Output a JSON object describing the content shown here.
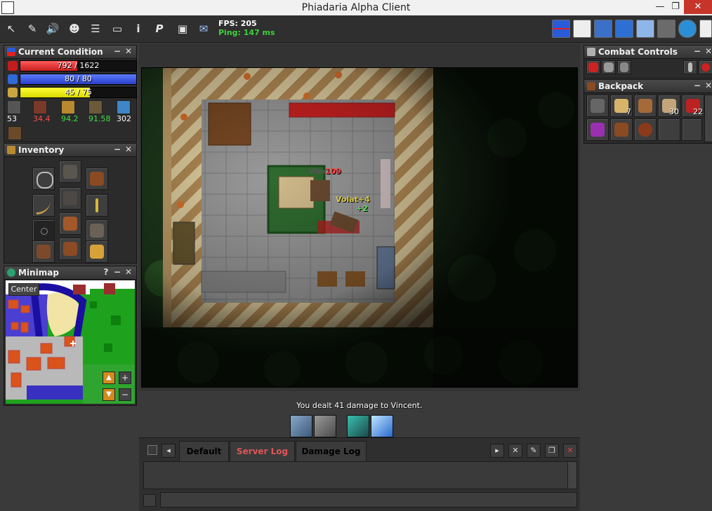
{
  "window": {
    "title": "Phiadaria Alpha Client",
    "minimize": "—",
    "restore": "❐",
    "close": "✕"
  },
  "toolbar": {
    "fps": "FPS: 205",
    "ping": "Ping: 147 ms",
    "left_icons": [
      "cursor-icon",
      "pen-icon",
      "speaker-icon",
      "character-icon",
      "list-icon",
      "window-icon",
      "info-icon",
      "premium-icon",
      "screenshot-icon",
      "scroll-icon"
    ],
    "left_glyphs": [
      "↖",
      "✎",
      "🔊",
      "☻",
      "☰",
      "▭",
      "i",
      "P",
      "▣",
      "✉"
    ],
    "right_icons": [
      "health-mana-icon",
      "notes-icon",
      "map-scroll-icon",
      "crossed-swords-icon",
      "party-icon",
      "skills-icon",
      "world-icon",
      "log-icon"
    ]
  },
  "condition": {
    "title": "Current Condition",
    "health": "792 / 1622",
    "mana": "80 / 80",
    "stamina": "45 / 75",
    "health_level": 0.49,
    "mana_level": 1.0,
    "stamina_level": 0.6,
    "stats": [
      {
        "value": "53",
        "color": "#ffffff"
      },
      {
        "value": "34.4",
        "color": "#ff4a4a"
      },
      {
        "value": "94.2",
        "color": "#3ee03e"
      },
      {
        "value": "91.58",
        "color": "#3ee03e"
      },
      {
        "value": "302",
        "color": "#ffffff"
      }
    ]
  },
  "inventory": {
    "title": "Inventory"
  },
  "minimap": {
    "title": "Minimap",
    "center_button": "Center",
    "help": "?",
    "zoom_in": "+",
    "zoom_out": "−"
  },
  "combat": {
    "title": "Combat Controls"
  },
  "backpack": {
    "title": "Backpack",
    "counts": [
      "",
      "7",
      "",
      "30",
      "22",
      "",
      "",
      "",
      "",
      ""
    ]
  },
  "game": {
    "damage_label_1": "109",
    "name_label_1": "Vinc",
    "name_label_2": "Volat+4",
    "heal_label": "+2",
    "message": "You dealt 41 damage to Vincent."
  },
  "chat": {
    "tabs": [
      "Default",
      "Server Log",
      "Damage Log"
    ],
    "tab_colors": [
      "#ffffff",
      "#e05555",
      "#ffffff"
    ]
  }
}
